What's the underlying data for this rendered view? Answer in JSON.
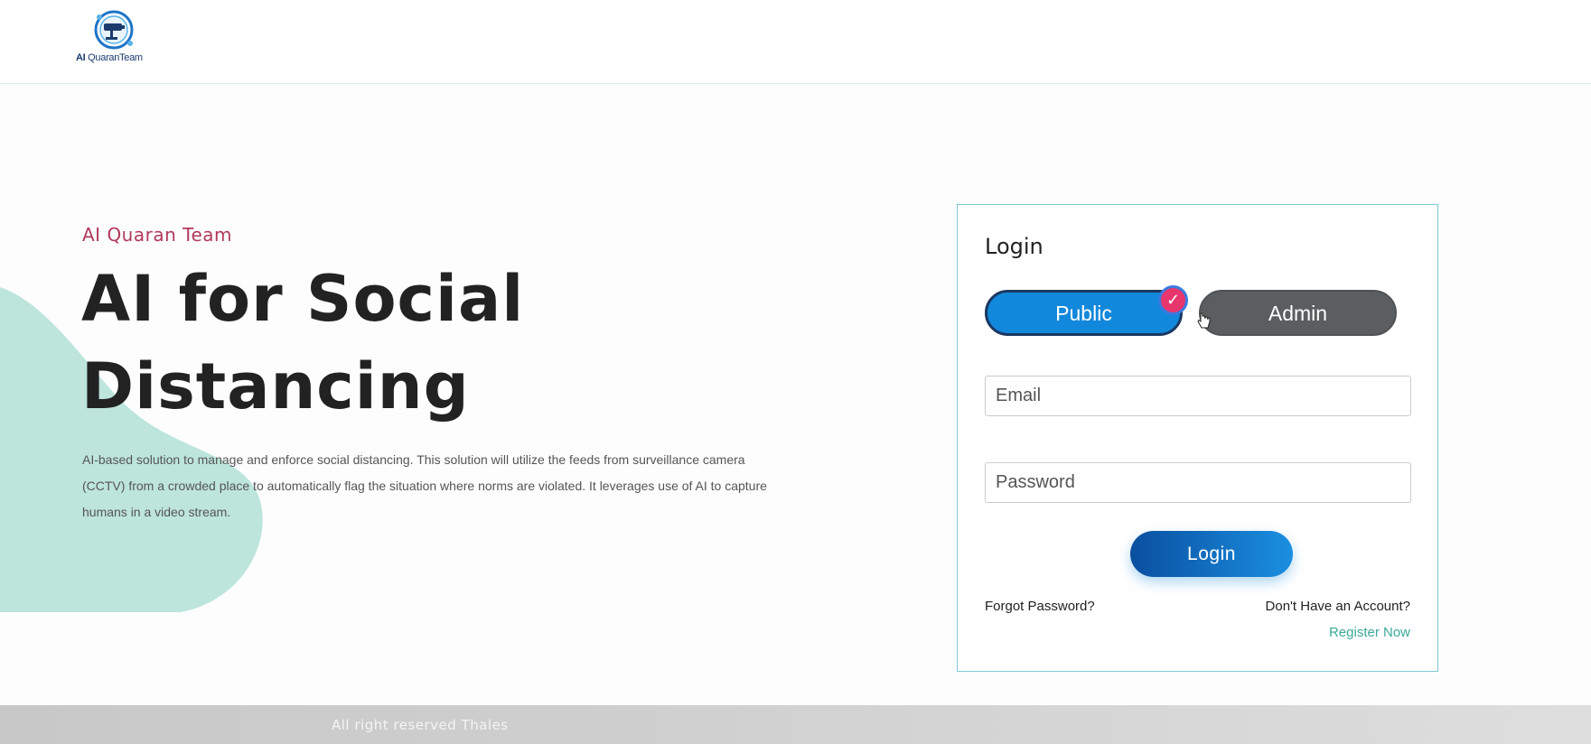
{
  "header": {
    "logo_text_bold": "AI",
    "logo_text_rest": "QuaranTeam",
    "logo_icon": "cctv-camera-logo-icon"
  },
  "hero": {
    "kicker": "AI Quaran Team",
    "headline_line1": "AI for Social",
    "headline_line2": "Distancing",
    "description": "AI-based solution to manage and enforce social distancing. This solution will utilize the feeds from surveillance camera (CCTV) from a crowded place to automatically flag the situation where norms are violated. It leverages use of AI to capture humans in a video stream."
  },
  "login": {
    "title": "Login",
    "toggle_public": "Public",
    "toggle_admin": "Admin",
    "selected_role": "Public",
    "email_placeholder": "Email",
    "password_placeholder": "Password",
    "login_button": "Login",
    "forgot_password": "Forgot Password?",
    "no_account": "Don't Have an Account?",
    "register": "Register Now"
  },
  "footer": {
    "text": "All right reserved Thales"
  },
  "colors": {
    "accent_blue": "#1288dc",
    "kicker_pink": "#b03a5b",
    "register_green": "#3aa89a",
    "blob_mint": "#bde5db",
    "check_badge": "#e8356d"
  }
}
